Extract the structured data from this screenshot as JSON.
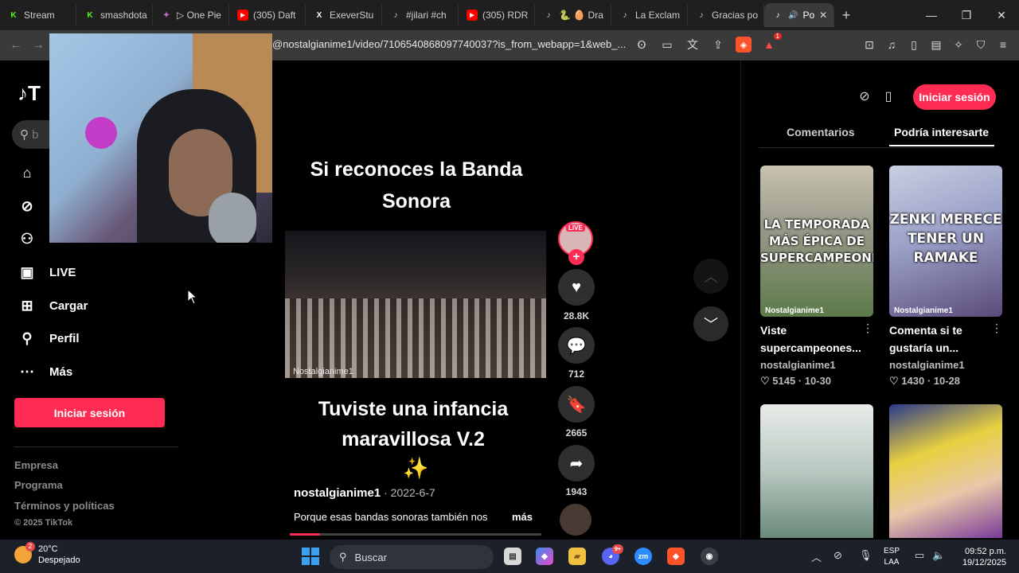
{
  "browser": {
    "tabs": [
      {
        "label": "Stream",
        "icon_color": "#53fc18",
        "icon": "K"
      },
      {
        "label": "smashdota",
        "icon_color": "#53fc18",
        "icon": "K"
      },
      {
        "label": "▷ One Pie",
        "icon_color": "#8a3fa0",
        "icon": "✦"
      },
      {
        "label": "(305) Daft",
        "icon_color": "#ff0000",
        "icon": "▶"
      },
      {
        "label": "ExeverStu",
        "icon_color": "#222222",
        "icon": "X"
      },
      {
        "label": "#jilari #ch",
        "icon_color": "#111111",
        "icon": "♪"
      },
      {
        "label": "(305) RDR",
        "icon_color": "#ff0000",
        "icon": "▶"
      },
      {
        "label": "🐍 🥚 Dra",
        "icon_color": "#111111",
        "icon": "♪"
      },
      {
        "label": "La Exclam",
        "icon_color": "#111111",
        "icon": "♪"
      },
      {
        "label": "Gracias po",
        "icon_color": "#111111",
        "icon": "♪"
      }
    ],
    "active_tab": {
      "label": "Po",
      "icon": "♪"
    },
    "url": "@nostalgianime1/video/7106540868097740037?is_from_webapp=1&web_...",
    "rewards_badge": "1"
  },
  "sidebar": {
    "search_placeholder": "b",
    "items": [
      {
        "label": "",
        "icon": "home-icon"
      },
      {
        "label": "",
        "icon": "compass-icon"
      },
      {
        "label": "",
        "icon": "following-icon"
      },
      {
        "label": "LIVE",
        "icon": "live-icon"
      },
      {
        "label": "Cargar",
        "icon": "upload-icon"
      },
      {
        "label": "Perfil",
        "icon": "profile-icon"
      },
      {
        "label": "Más",
        "icon": "more-icon"
      }
    ],
    "login_label": "Iniciar sesión",
    "footer_links": [
      "Empresa",
      "Programa",
      "Términos y políticas"
    ],
    "copyright": "© 2025 TikTok"
  },
  "video": {
    "caption_top": "Si reconoces la Banda Sonora",
    "watermark": "Nostalgianime1",
    "caption_bottom": "Tuviste una infancia maravillosa V.2",
    "sparkle": "✨",
    "author": "nostalgianime1",
    "date": "2022-6-7",
    "description": "Porque esas bandas sonoras también nos",
    "more_label": "más",
    "progress": 0.12
  },
  "actions": {
    "live_tag": "LIVE",
    "likes": "28.8K",
    "comments": "712",
    "saves": "2665",
    "shares": "1943"
  },
  "right_panel": {
    "login_label": "Iniciar sesión",
    "tab_comments": "Comentarios",
    "tab_recommended": "Podría interesarte",
    "cards": [
      {
        "thumb_text": "LA TEMPORADA MÁS ÉPICA DE SUPERCAMPEONES",
        "title": "Viste supercampeones...",
        "author": "nostalgianime1",
        "likes": "5145",
        "date": "10-30"
      },
      {
        "thumb_text": "ZENKI MERECE TENER UN RAMAKE",
        "title": "Comenta si te gustaría un...",
        "author": "nostalgianime1",
        "likes": "1430",
        "date": "10-28"
      }
    ],
    "thumb_watermark": "Nostalgianime1"
  },
  "taskbar": {
    "temperature": "20°C",
    "weather": "Despejado",
    "weather_badge": "2",
    "search_label": "Buscar",
    "lang_top": "ESP",
    "lang_bottom": "LAA",
    "time": "09:52 p.m.",
    "date": "19/12/2025",
    "discord_badge": "9+"
  }
}
